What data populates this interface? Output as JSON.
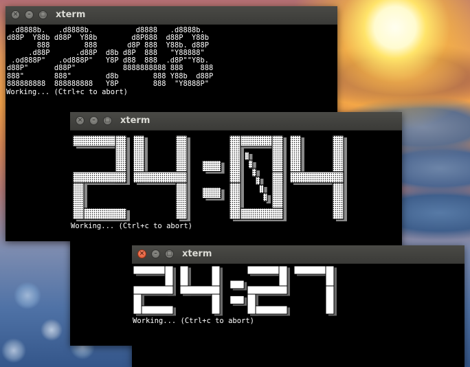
{
  "desktop": {
    "wallpaper": "sunset-stone-stack"
  },
  "windows": [
    {
      "title": "xterm",
      "ascii_art": [
        " .d8888b.   .d8888b.          d8888   .d8888b.",
        "d88P  Y88b d88P  Y88b        d8P888  d88P  Y88b",
        "       888        888       d8P 888  Y88b. d88P",
        "     .d88P      .d88P  d8b d8P  888   \"Y88888\"",
        " .od888P\"   .od888P\"   Y8P d88  888  .d8P\"\"Y8b.",
        "d88P\"      d88P\"           8888888888 888    888",
        "888\"       888\"        d8b        888 Y88b  d88P",
        "888888888  888888888   Y8P        888  \"Y8888P\""
      ],
      "status": "Working... (Ctrl+c to abort)"
    },
    {
      "title": "xterm",
      "clock": "24:04",
      "status": "Working... (Ctrl+c to abort)"
    },
    {
      "title": "xterm",
      "clock": "24:27",
      "status": "Working... (Ctrl+c to abort)"
    }
  ],
  "icons": {
    "close": "close-icon",
    "minimize": "minimize-icon",
    "maximize": "maximize-icon"
  },
  "colors": {
    "terminal_bg": "#000000",
    "terminal_fg": "#ffffff",
    "titlebar": "#3c3b37",
    "close_active": "#e65a34"
  }
}
